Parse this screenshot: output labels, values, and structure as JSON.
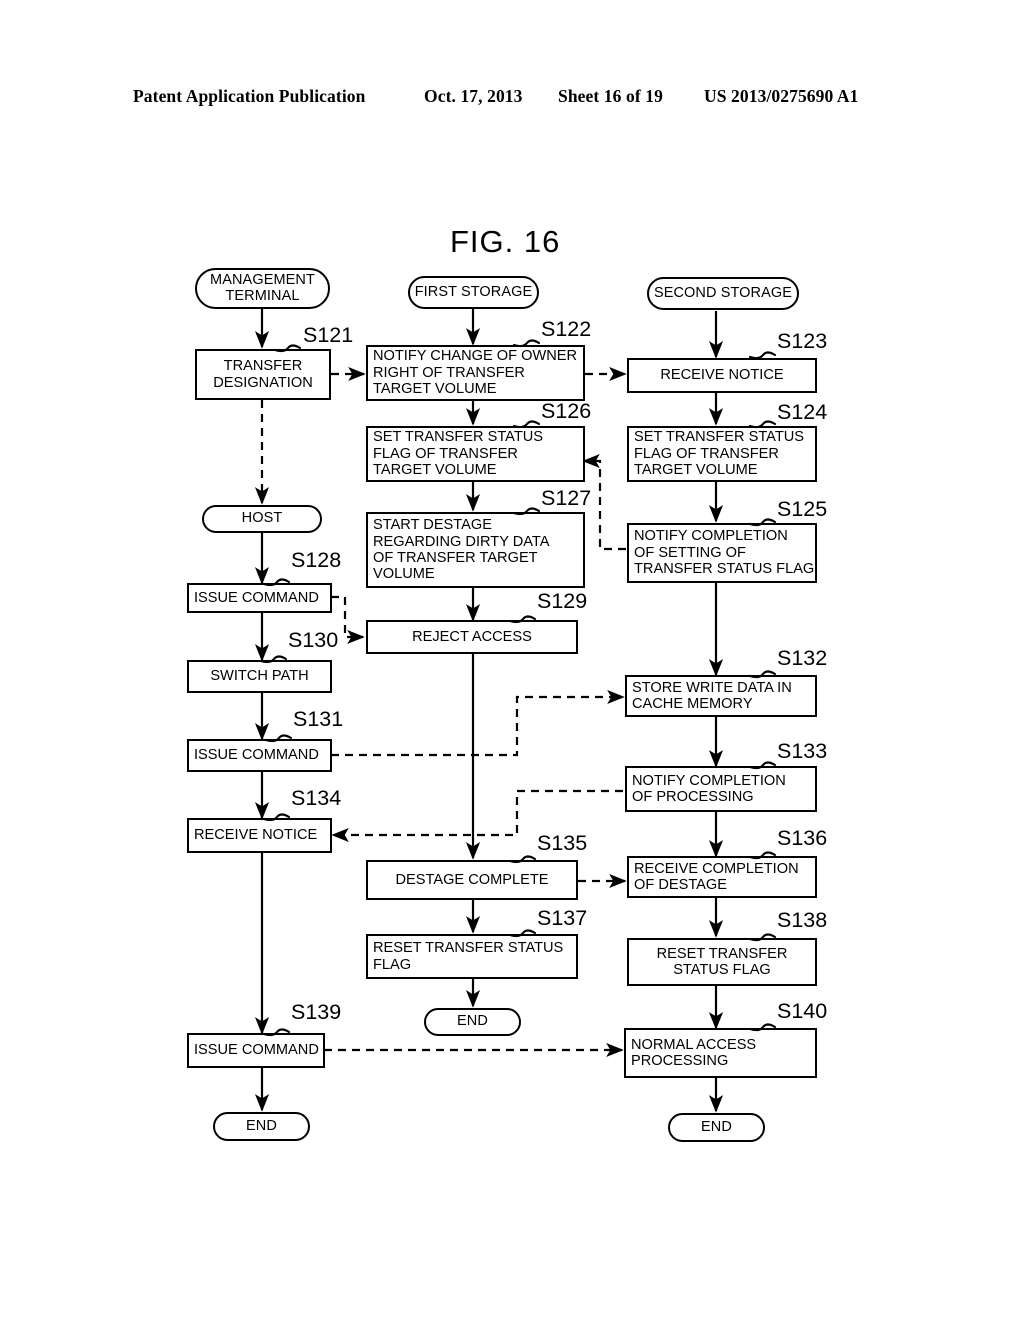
{
  "header": {
    "publication": "Patent Application Publication",
    "date": "Oct. 17, 2013",
    "sheet": "Sheet 16 of 19",
    "number": "US 2013/0275690 A1"
  },
  "figure": {
    "title": "FIG. 16"
  },
  "lanes": [
    {
      "id": "management-terminal",
      "label": "MANAGEMENT\nTERMINAL"
    },
    {
      "id": "first-storage",
      "label": "FIRST STORAGE"
    },
    {
      "id": "second-storage",
      "label": "SECOND STORAGE"
    }
  ],
  "nodes": {
    "management_terminal": "MANAGEMENT\nTERMINAL",
    "first_storage": "FIRST STORAGE",
    "second_storage": "SECOND STORAGE",
    "host": "HOST",
    "s121": "TRANSFER\nDESIGNATION",
    "s122": "NOTIFY CHANGE OF OWNER\nRIGHT OF TRANSFER\nTARGET VOLUME",
    "s123": "RECEIVE NOTICE",
    "s124": "SET TRANSFER STATUS\nFLAG OF TRANSFER\nTARGET VOLUME",
    "s125": "NOTIFY COMPLETION\nOF SETTING OF\nTRANSFER STATUS FLAG",
    "s126": "SET TRANSFER STATUS\nFLAG OF TRANSFER\nTARGET VOLUME",
    "s127": "START DESTAGE\nREGARDING DIRTY DATA\nOF TRANSFER  TARGET\nVOLUME",
    "s128": "ISSUE COMMAND",
    "s129": "REJECT ACCESS",
    "s130": "SWITCH PATH",
    "s131": "ISSUE COMMAND",
    "s132": "STORE WRITE DATA IN\nCACHE MEMORY",
    "s133": "NOTIFY COMPLETION\nOF PROCESSING",
    "s134": "RECEIVE NOTICE",
    "s135": "DESTAGE COMPLETE",
    "s136": "RECEIVE COMPLETION\nOF DESTAGE",
    "s137": "RESET TRANSFER STATUS\nFLAG",
    "s138": "RESET TRANSFER\nSTATUS FLAG",
    "s139": "ISSUE COMMAND",
    "s140": "NORMAL ACCESS\nPROCESSING",
    "end_left": "END",
    "end_mid": "END",
    "end_right": "END"
  },
  "step_labels": {
    "s121": "S121",
    "s122": "S122",
    "s123": "S123",
    "s124": "S124",
    "s125": "S125",
    "s126": "S126",
    "s127": "S127",
    "s128": "S128",
    "s129": "S129",
    "s130": "S130",
    "s131": "S131",
    "s132": "S132",
    "s133": "S133",
    "s134": "S134",
    "s135": "S135",
    "s136": "S136",
    "s137": "S137",
    "s138": "S138",
    "s139": "S139",
    "s140": "S140"
  },
  "colors": {
    "ink": "#000000",
    "paper": "#ffffff"
  }
}
